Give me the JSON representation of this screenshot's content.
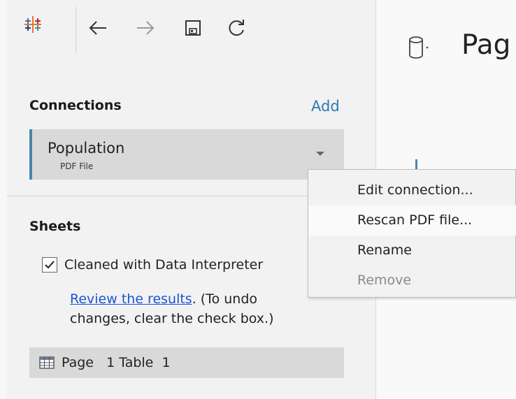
{
  "toolbar": {
    "logo_icon": "tableau-logo-icon",
    "back_icon": "arrow-left-icon",
    "forward_icon": "arrow-right-icon",
    "save_icon": "save-icon",
    "refresh_icon": "refresh-icon"
  },
  "header": {
    "datasource_icon": "cylinder-icon",
    "title": "Pag"
  },
  "connections": {
    "title": "Connections",
    "add_label": "Add",
    "item": {
      "name": "Population",
      "type": "PDF File"
    }
  },
  "sheets": {
    "title": "Sheets",
    "interpreter_label": "Cleaned with Data Interpreter",
    "interpreter_checked": true,
    "review_link": "Review the results",
    "review_suffix": ". (To undo changes, clear the check box.)",
    "table_item": "Page   1 Table  1"
  },
  "context_menu": {
    "items": [
      {
        "label": "Edit connection...",
        "enabled": true
      },
      {
        "label": "Rescan PDF file...",
        "enabled": true
      },
      {
        "label": "Rename",
        "enabled": true
      },
      {
        "label": "Remove",
        "enabled": false
      }
    ]
  },
  "colors": {
    "accent": "#4a86a8",
    "link": "#1a55d6",
    "add_link": "#2c7bb0"
  }
}
